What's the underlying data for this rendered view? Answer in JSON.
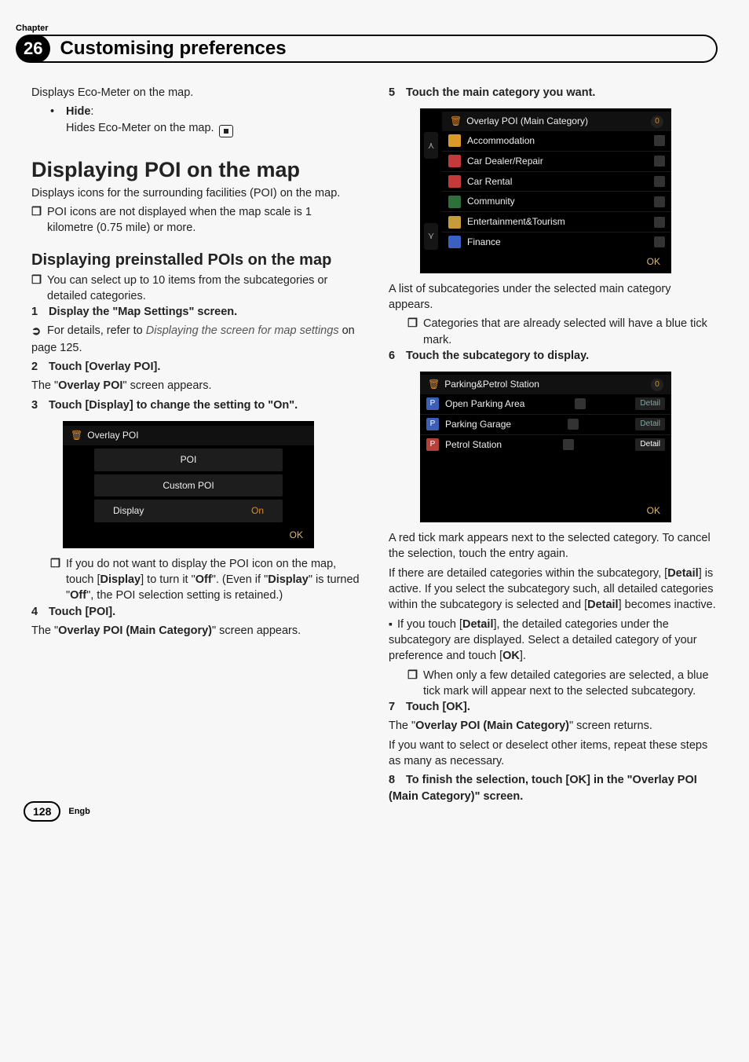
{
  "header": {
    "chapter_label": "Chapter",
    "chapter_number": "26",
    "chapter_title": "Customising preferences"
  },
  "left": {
    "intro_line": "Displays Eco-Meter on the map.",
    "hide_label": "Hide",
    "hide_desc": "Hides Eco-Meter on the map.",
    "section_big": "Displaying POI on the map",
    "section_big_desc1": "Displays icons for the surrounding facilities (POI) on the map.",
    "note1": "POI icons are not displayed when the map scale is 1 kilometre (0.75 mile) or more.",
    "section_med": "Displaying preinstalled POIs on the map",
    "note2": "You can select up to 10 items from the subcategories or detailed categories.",
    "step1": "Display the \"Map Settings\" screen.",
    "step1_sub_prefix": "For details, refer to ",
    "step1_sub_em": "Displaying the screen for map settings",
    "step1_sub_suffix": " on page 125.",
    "step2": "Touch [Overlay POI].",
    "step2_body_a": "The \"",
    "step2_body_b": "Overlay POI",
    "step2_body_c": "\" screen appears.",
    "step3": "Touch [Display] to change the setting to \"On\".",
    "shot1": {
      "title": "Overlay POI",
      "btn_poi": "POI",
      "btn_custom": "Custom POI",
      "btn_display": "Display",
      "display_val": "On",
      "ok": "OK"
    },
    "note3_a": "If you do not want to display the POI icon on the map, touch [",
    "note3_b": "Display",
    "note3_c": "] to turn it \"",
    "note3_d": "Off",
    "note3_e": "\". (Even if \"",
    "note3_f": "Display",
    "note3_g": "\" is turned \"",
    "note3_h": "Off",
    "note3_i": "\", the POI selection setting is retained.)",
    "step4": "Touch [POI].",
    "step4_body_a": "The \"",
    "step4_body_b": "Overlay POI (Main Category)",
    "step4_body_c": "\" screen appears."
  },
  "right": {
    "step5": "Touch the main category you want.",
    "shot2": {
      "title": "Overlay POI (Main Category)",
      "count": "0",
      "items": [
        "Accommodation",
        "Car Dealer/Repair",
        "Car Rental",
        "Community",
        "Entertainment&Tourism",
        "Finance"
      ],
      "icon_colors": [
        "#d99a2a",
        "#c43a3a",
        "#c43a3a",
        "#2f6f3a",
        "#c79a3a",
        "#3a60c4"
      ],
      "ok": "OK"
    },
    "after5": "A list of subcategories under the selected main category appears.",
    "note5": "Categories that are already selected will have a blue tick mark.",
    "step6": "Touch the subcategory to display.",
    "shot3": {
      "title": "Parking&Petrol Station",
      "count": "0",
      "items": [
        "Open Parking Area",
        "Parking Garage",
        "Petrol Station"
      ],
      "icon_colors": [
        "#3a5fb5",
        "#3a5fb5",
        "#b5423a"
      ],
      "detail": "Detail",
      "ok": "OK"
    },
    "after6_p1": "A red tick mark appears next to the selected category. To cancel the selection, touch the entry again.",
    "after6_p2_a": "If there are detailed categories within the subcategory, [",
    "after6_p2_b": "Detail",
    "after6_p2_c": "] is active. If you select the subcategory such, all detailed categories within the subcategory is selected and [",
    "after6_p2_d": "Detail",
    "after6_p2_e": "] becomes inactive.",
    "bullet6_a": "If you touch [",
    "bullet6_b": "Detail",
    "bullet6_c": "], the detailed categories under the subcategory are displayed. Select a detailed category of your preference and touch [",
    "bullet6_d": "OK",
    "bullet6_e": "].",
    "note6": "When only a few detailed categories are selected, a blue tick mark will appear next to the selected subcategory.",
    "step7": "Touch [OK].",
    "step7_body_a": "The \"",
    "step7_body_b": "Overlay POI (Main Category)",
    "step7_body_c": "\" screen returns.",
    "step7_p2": "If you want to select or deselect other items, repeat these steps as many as necessary.",
    "step8": "To finish the selection, touch [OK] in the \"Overlay POI (Main Category)\" screen."
  },
  "footer": {
    "page": "128",
    "lang": "Engb"
  }
}
